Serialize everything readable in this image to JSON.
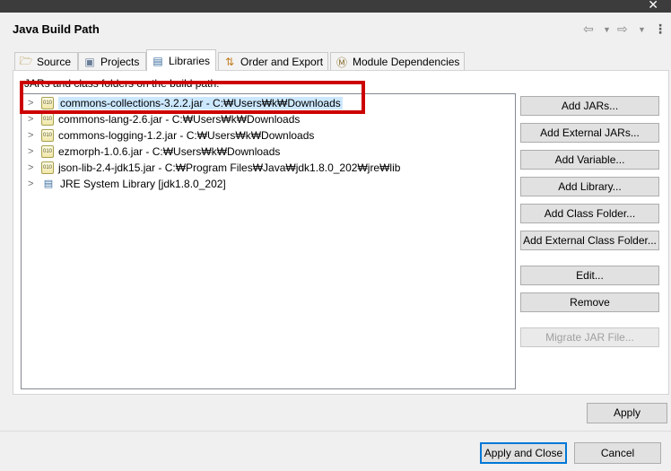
{
  "window": {
    "title": "Java Build Path",
    "close_glyph": "✕"
  },
  "nav": {
    "back": "⇦",
    "dropdown": "▼",
    "forward": "⇨",
    "more": "⋮"
  },
  "tabs": [
    {
      "label": "Source",
      "icon": "source-folder-icon",
      "active": false
    },
    {
      "label": "Projects",
      "icon": "projects-icon",
      "active": false
    },
    {
      "label": "Libraries",
      "icon": "libraries-icon",
      "active": true
    },
    {
      "label": "Order and Export",
      "icon": "order-export-icon",
      "active": false
    },
    {
      "label": "Module Dependencies",
      "icon": "module-icon",
      "active": false
    }
  ],
  "instruction": "JARs and class folders on the build path:",
  "entries": [
    {
      "label": "commons-collections-3.2.2.jar - C:₩Users₩k₩Downloads",
      "icon": "jar-icon",
      "selected": true
    },
    {
      "label": "commons-lang-2.6.jar - C:₩Users₩k₩Downloads",
      "icon": "jar-icon",
      "selected": false
    },
    {
      "label": "commons-logging-1.2.jar - C:₩Users₩k₩Downloads",
      "icon": "jar-icon",
      "selected": false
    },
    {
      "label": "ezmorph-1.0.6.jar - C:₩Users₩k₩Downloads",
      "icon": "jar-icon",
      "selected": false
    },
    {
      "label": "json-lib-2.4-jdk15.jar - C:₩Program Files₩Java₩jdk1.8.0_202₩jre₩lib",
      "icon": "jar-icon",
      "selected": false
    },
    {
      "label": "JRE System Library [jdk1.8.0_202]",
      "icon": "library-icon",
      "selected": false
    }
  ],
  "buttons": {
    "add_jars": "Add JARs...",
    "add_external_jars": "Add External JARs...",
    "add_variable": "Add Variable...",
    "add_library": "Add Library...",
    "add_class_folder": "Add Class Folder...",
    "add_external_class_folder": "Add External Class Folder...",
    "edit": "Edit...",
    "remove": "Remove",
    "migrate_jar": "Migrate JAR File...",
    "apply": "Apply",
    "apply_and_close": "Apply and Close",
    "cancel": "Cancel"
  },
  "colors": {
    "highlight": "#cc0000",
    "selection": "#cce8ff",
    "accent": "#0078d7"
  }
}
